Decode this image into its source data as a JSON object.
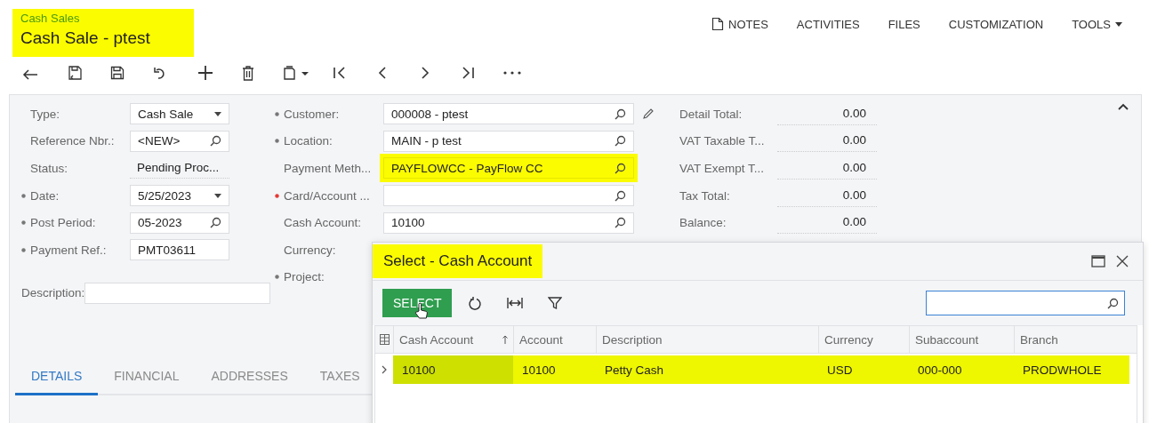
{
  "header": {
    "breadcrumb": "Cash Sales",
    "title": "Cash Sale - ptest",
    "highlighted": true
  },
  "top_menu": [
    {
      "label": "NOTES",
      "kind": "note"
    },
    {
      "label": "ACTIVITIES",
      "kind": "plain"
    },
    {
      "label": "FILES",
      "kind": "plain"
    },
    {
      "label": "CUSTOMIZATION",
      "kind": "plain"
    },
    {
      "label": "TOOLS",
      "kind": "dropdown"
    }
  ],
  "form": {
    "left": [
      {
        "label": "Type:",
        "required": false,
        "value": "Cash Sale",
        "kind": "dropdown"
      },
      {
        "label": "Reference Nbr.:",
        "required": false,
        "value": "<NEW>",
        "kind": "lookup"
      },
      {
        "label": "Status:",
        "required": false,
        "value": "Pending Proc...",
        "kind": "readonly"
      },
      {
        "label": "Date:",
        "required": true,
        "value": "5/25/2023",
        "kind": "dropdown"
      },
      {
        "label": "Post Period:",
        "required": true,
        "value": "05-2023",
        "kind": "lookup"
      },
      {
        "label": "Payment Ref.:",
        "required": true,
        "value": "PMT03611",
        "kind": "text"
      }
    ],
    "middle": [
      {
        "label": "Customer:",
        "required": true,
        "error": false,
        "value": "000008 - ptest",
        "kind": "lookup_edit",
        "highlighted": false
      },
      {
        "label": "Location:",
        "required": true,
        "error": false,
        "value": "MAIN - p test",
        "kind": "lookup",
        "highlighted": false
      },
      {
        "label": "Payment Meth...",
        "required": false,
        "error": false,
        "value": "PAYFLOWCC - PayFlow CC",
        "kind": "lookup",
        "highlighted": true
      },
      {
        "label": "Card/Account ...",
        "required": true,
        "error": true,
        "kind": "lookup",
        "highlighted": false
      },
      {
        "label": "Cash Account:",
        "required": false,
        "error": false,
        "value": "10100",
        "kind": "lookup",
        "highlighted": false
      },
      {
        "label": "Currency:",
        "required": false,
        "error": false,
        "kind": "hidden",
        "highlighted": false
      },
      {
        "label": "Project:",
        "required": true,
        "error": false,
        "kind": "hidden",
        "highlighted": false
      }
    ],
    "totals": [
      {
        "label": "Detail Total:",
        "value": "0.00"
      },
      {
        "label": "VAT Taxable T...",
        "value": "0.00"
      },
      {
        "label": "VAT Exempt T...",
        "value": "0.00"
      },
      {
        "label": "Tax Total:",
        "value": "0.00"
      },
      {
        "label": "Balance:",
        "value": "0.00"
      }
    ],
    "description": {
      "label": "Description:"
    }
  },
  "tabs": [
    {
      "label": "DETAILS",
      "selected": true
    },
    {
      "label": "FINANCIAL",
      "selected": false
    },
    {
      "label": "ADDRESSES",
      "selected": false
    },
    {
      "label": "TAXES",
      "selected": false
    }
  ],
  "dialog": {
    "title": "Select - Cash Account",
    "highlighted": true,
    "select_button": "SELECT",
    "columns": [
      {
        "label": "Cash Account",
        "sorted": true
      },
      {
        "label": "Account",
        "sorted": false
      },
      {
        "label": "Description",
        "sorted": false
      },
      {
        "label": "Currency",
        "sorted": false
      },
      {
        "label": "Subaccount",
        "sorted": false
      },
      {
        "label": "Branch",
        "sorted": false
      }
    ],
    "rows": [
      {
        "cells": [
          "10100",
          "10100",
          "Petty Cash",
          "USD",
          "000-000",
          "PRODWHOLE"
        ],
        "selected": true
      }
    ]
  }
}
